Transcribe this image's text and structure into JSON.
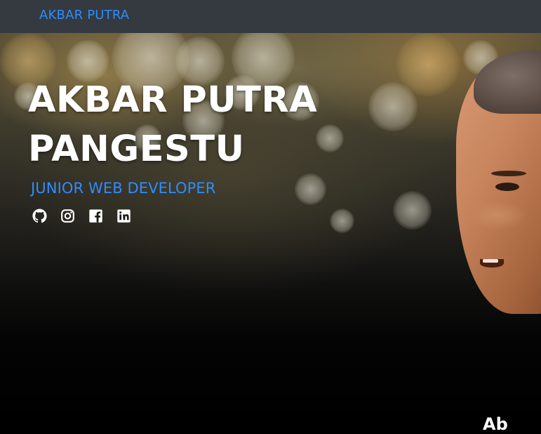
{
  "navbar": {
    "brand": "AKBAR PUTRA"
  },
  "hero": {
    "title": "AKBAR PUTRA PANGESTU",
    "subtitle": "JUNIOR WEB DEVELOPER",
    "socials": [
      {
        "icon": "github-icon"
      },
      {
        "icon": "instagram-icon"
      },
      {
        "icon": "facebook-icon"
      },
      {
        "icon": "linkedin-icon"
      }
    ]
  },
  "next_section": {
    "heading_fragment": "Ab"
  },
  "colors": {
    "navbar_bg": "#343a40",
    "accent": "#2f8cff",
    "title": "#ffffff"
  }
}
